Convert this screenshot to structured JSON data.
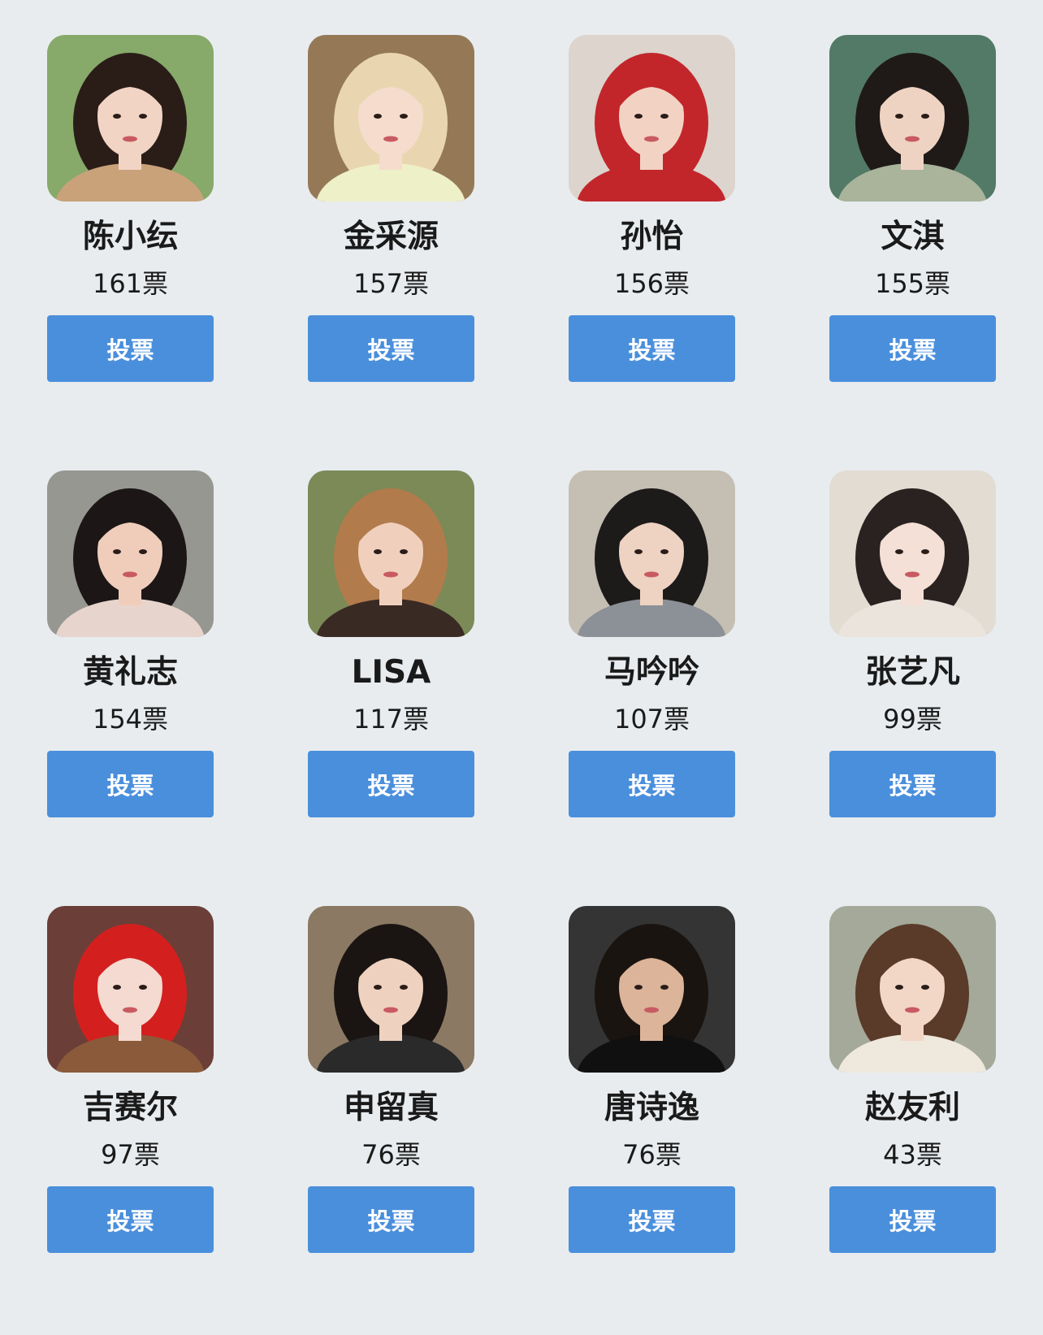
{
  "vote_label": "投票",
  "candidates": [
    {
      "name": "陈小纭",
      "votes": "161票",
      "photo": "photo-straw-hat-field",
      "bg": "#7aa05a",
      "hair": "#2a1d18",
      "skin": "#f1d4c4",
      "top": "#c9a27a"
    },
    {
      "name": "金采源",
      "votes": "157票",
      "photo": "photo-bamboo-blonde",
      "bg": "#8a6a45",
      "hair": "#e9d6b0",
      "skin": "#f5dccd",
      "top": "#eef0c8"
    },
    {
      "name": "孙怡",
      "votes": "156票",
      "photo": "photo-red-hair-smile",
      "bg": "#d9d0c8",
      "hair": "#c2262b",
      "skin": "#f2d2c3",
      "top": "#c2262b"
    },
    {
      "name": "文淇",
      "votes": "155票",
      "photo": "photo-green-window",
      "bg": "#3f6b55",
      "hair": "#1f1a18",
      "skin": "#efd3c2",
      "top": "#a9b49b"
    },
    {
      "name": "黄礼志",
      "votes": "154票",
      "photo": "photo-heart-hands",
      "bg": "#8c8c86",
      "hair": "#1c1716",
      "skin": "#f0cdbb",
      "top": "#e7d5cd"
    },
    {
      "name": "LISA",
      "votes": "117票",
      "photo": "photo-brown-jacket",
      "bg": "#6d7d45",
      "hair": "#b27b4c",
      "skin": "#f0d0bd",
      "top": "#3a2a24"
    },
    {
      "name": "马吟吟",
      "votes": "107票",
      "photo": "photo-car-interior",
      "bg": "#bfb7aa",
      "hair": "#1d1a1a",
      "skin": "#eed2c2",
      "top": "#8c9097"
    },
    {
      "name": "张艺凡",
      "votes": "99票",
      "photo": "photo-light-portrait",
      "bg": "#dfd9cf",
      "hair": "#2a2220",
      "skin": "#f4e0d6",
      "top": "#ebe4dc"
    },
    {
      "name": "吉赛尔",
      "votes": "97票",
      "photo": "photo-red-hair-leopard",
      "bg": "#5b2a22",
      "hair": "#d41f1f",
      "skin": "#f4dad0",
      "top": "#8a5a3a"
    },
    {
      "name": "申留真",
      "votes": "76票",
      "photo": "photo-cafe-portrait",
      "bg": "#7e6a52",
      "hair": "#1a1512",
      "skin": "#efd1bf",
      "top": "#2a2a2a"
    },
    {
      "name": "唐诗逸",
      "votes": "76票",
      "photo": "photo-night-pool",
      "bg": "#1c1e1c",
      "hair": "#1a1410",
      "skin": "#dcb49a",
      "top": "#101010"
    },
    {
      "name": "赵友利",
      "votes": "43票",
      "photo": "photo-drink-outdoor",
      "bg": "#9aa08e",
      "hair": "#5a3a28",
      "skin": "#f2d6c6",
      "top": "#efe8dc"
    }
  ]
}
